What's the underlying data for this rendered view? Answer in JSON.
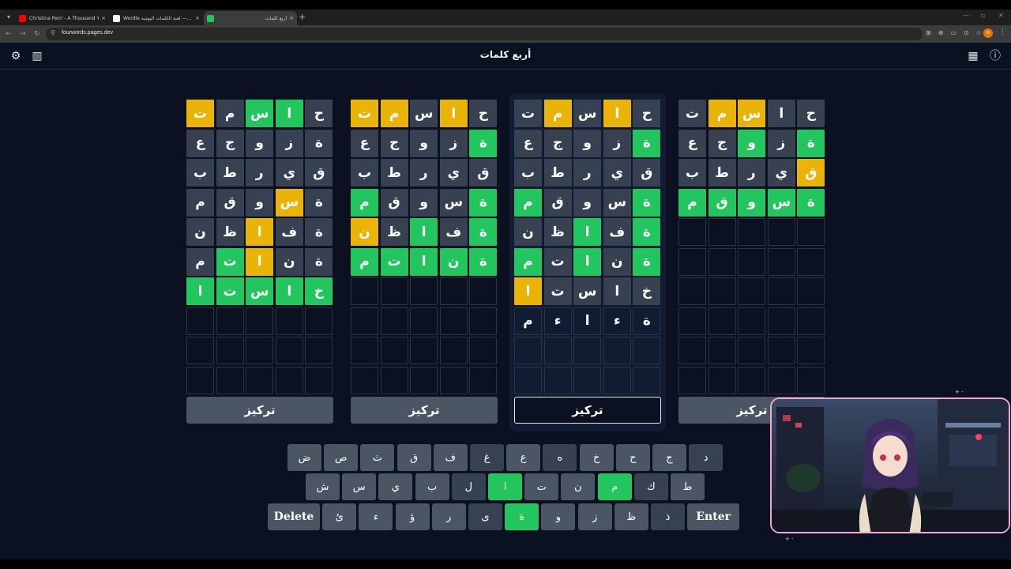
{
  "browser": {
    "tabs": [
      {
        "title": "Christina Perri - A Thousand Ye...",
        "favicon_color": "#ff0000",
        "active": false
      },
      {
        "title": "Wordle لعبة الكلمات اليومية —...",
        "favicon_color": "#ffffff",
        "active": false
      },
      {
        "title": "أربع كلمات",
        "favicon_color": "#22c55e",
        "active": true
      }
    ],
    "new_tab": "+",
    "close": "×",
    "url": "fourwords.pages.dev",
    "profile_initials": "N"
  },
  "app": {
    "title": "أربع كلمات",
    "icons": {
      "settings": "⚙",
      "stats": "▥",
      "calendar": "▦",
      "info": "ⓘ"
    }
  },
  "boards": [
    {
      "rows": [
        [
          [
            "ت",
            "y"
          ],
          [
            "م",
            "n"
          ],
          [
            "س",
            "g"
          ],
          [
            "ا",
            "g"
          ],
          [
            "ح",
            "n"
          ]
        ],
        [
          [
            "ع",
            "n"
          ],
          [
            "ج",
            "n"
          ],
          [
            "و",
            "n"
          ],
          [
            "ز",
            "n"
          ],
          [
            "ة",
            "n"
          ]
        ],
        [
          [
            "ب",
            "n"
          ],
          [
            "ط",
            "n"
          ],
          [
            "ر",
            "n"
          ],
          [
            "ي",
            "n"
          ],
          [
            "ق",
            "n"
          ]
        ],
        [
          [
            "م",
            "n"
          ],
          [
            "ق",
            "n"
          ],
          [
            "و",
            "n"
          ],
          [
            "س",
            "y"
          ],
          [
            "ة",
            "n"
          ]
        ],
        [
          [
            "ن",
            "n"
          ],
          [
            "ظ",
            "n"
          ],
          [
            "ا",
            "y"
          ],
          [
            "ف",
            "n"
          ],
          [
            "ة",
            "n"
          ]
        ],
        [
          [
            "م",
            "n"
          ],
          [
            "ت",
            "g"
          ],
          [
            "ا",
            "y"
          ],
          [
            "ن",
            "n"
          ],
          [
            "ة",
            "n"
          ]
        ],
        [
          [
            "ا",
            "g"
          ],
          [
            "ت",
            "g"
          ],
          [
            "س",
            "g"
          ],
          [
            "ا",
            "g"
          ],
          [
            "خ",
            "g"
          ]
        ],
        [
          [
            "",
            "e"
          ],
          [
            "",
            "e"
          ],
          [
            "",
            "e"
          ],
          [
            "",
            "e"
          ],
          [
            "",
            "e"
          ]
        ],
        [
          [
            "",
            "e"
          ],
          [
            "",
            "e"
          ],
          [
            "",
            "e"
          ],
          [
            "",
            "e"
          ],
          [
            "",
            "e"
          ]
        ],
        [
          [
            "",
            "e"
          ],
          [
            "",
            "e"
          ],
          [
            "",
            "e"
          ],
          [
            "",
            "e"
          ],
          [
            "",
            "e"
          ]
        ]
      ],
      "focus_label": "تركيز",
      "selected": false
    },
    {
      "rows": [
        [
          [
            "ت",
            "y"
          ],
          [
            "م",
            "y"
          ],
          [
            "س",
            "n"
          ],
          [
            "ا",
            "y"
          ],
          [
            "ح",
            "n"
          ]
        ],
        [
          [
            "ع",
            "n"
          ],
          [
            "ج",
            "n"
          ],
          [
            "و",
            "n"
          ],
          [
            "ز",
            "n"
          ],
          [
            "ة",
            "g"
          ]
        ],
        [
          [
            "ب",
            "n"
          ],
          [
            "ط",
            "n"
          ],
          [
            "ر",
            "n"
          ],
          [
            "ي",
            "n"
          ],
          [
            "ق",
            "n"
          ]
        ],
        [
          [
            "م",
            "g"
          ],
          [
            "ق",
            "n"
          ],
          [
            "و",
            "n"
          ],
          [
            "س",
            "n"
          ],
          [
            "ة",
            "g"
          ]
        ],
        [
          [
            "ن",
            "y"
          ],
          [
            "ظ",
            "n"
          ],
          [
            "ا",
            "g"
          ],
          [
            "ف",
            "n"
          ],
          [
            "ة",
            "g"
          ]
        ],
        [
          [
            "م",
            "g"
          ],
          [
            "ت",
            "g"
          ],
          [
            "ا",
            "g"
          ],
          [
            "ن",
            "g"
          ],
          [
            "ة",
            "g"
          ]
        ],
        [
          [
            "",
            "e"
          ],
          [
            "",
            "e"
          ],
          [
            "",
            "e"
          ],
          [
            "",
            "e"
          ],
          [
            "",
            "e"
          ]
        ],
        [
          [
            "",
            "e"
          ],
          [
            "",
            "e"
          ],
          [
            "",
            "e"
          ],
          [
            "",
            "e"
          ],
          [
            "",
            "e"
          ]
        ],
        [
          [
            "",
            "e"
          ],
          [
            "",
            "e"
          ],
          [
            "",
            "e"
          ],
          [
            "",
            "e"
          ],
          [
            "",
            "e"
          ]
        ],
        [
          [
            "",
            "e"
          ],
          [
            "",
            "e"
          ],
          [
            "",
            "e"
          ],
          [
            "",
            "e"
          ],
          [
            "",
            "e"
          ]
        ]
      ],
      "focus_label": "تركيز",
      "selected": false
    },
    {
      "rows": [
        [
          [
            "ت",
            "n"
          ],
          [
            "م",
            "y"
          ],
          [
            "س",
            "n"
          ],
          [
            "ا",
            "y"
          ],
          [
            "ح",
            "n"
          ]
        ],
        [
          [
            "ع",
            "n"
          ],
          [
            "ج",
            "n"
          ],
          [
            "و",
            "n"
          ],
          [
            "ز",
            "n"
          ],
          [
            "ة",
            "g"
          ]
        ],
        [
          [
            "ب",
            "n"
          ],
          [
            "ط",
            "n"
          ],
          [
            "ر",
            "n"
          ],
          [
            "ي",
            "n"
          ],
          [
            "ق",
            "n"
          ]
        ],
        [
          [
            "م",
            "g"
          ],
          [
            "ق",
            "n"
          ],
          [
            "و",
            "n"
          ],
          [
            "س",
            "n"
          ],
          [
            "ة",
            "g"
          ]
        ],
        [
          [
            "ن",
            "n"
          ],
          [
            "ظ",
            "n"
          ],
          [
            "ا",
            "g"
          ],
          [
            "ف",
            "n"
          ],
          [
            "ة",
            "g"
          ]
        ],
        [
          [
            "م",
            "g"
          ],
          [
            "ت",
            "n"
          ],
          [
            "ا",
            "g"
          ],
          [
            "ن",
            "n"
          ],
          [
            "ة",
            "g"
          ]
        ],
        [
          [
            "ا",
            "y"
          ],
          [
            "ت",
            "n"
          ],
          [
            "س",
            "n"
          ],
          [
            "ا",
            "n"
          ],
          [
            "خ",
            "n"
          ]
        ],
        [
          [
            "م",
            "t"
          ],
          [
            "ء",
            "t"
          ],
          [
            "ا",
            "t"
          ],
          [
            "ء",
            "t"
          ],
          [
            "ة",
            "t"
          ]
        ],
        [
          [
            "",
            "e"
          ],
          [
            "",
            "e"
          ],
          [
            "",
            "e"
          ],
          [
            "",
            "e"
          ],
          [
            "",
            "e"
          ]
        ],
        [
          [
            "",
            "e"
          ],
          [
            "",
            "e"
          ],
          [
            "",
            "e"
          ],
          [
            "",
            "e"
          ],
          [
            "",
            "e"
          ]
        ]
      ],
      "focus_label": "تركيز",
      "selected": true
    },
    {
      "rows": [
        [
          [
            "ت",
            "n"
          ],
          [
            "م",
            "y"
          ],
          [
            "س",
            "y"
          ],
          [
            "ا",
            "n"
          ],
          [
            "ح",
            "n"
          ]
        ],
        [
          [
            "ع",
            "n"
          ],
          [
            "ج",
            "n"
          ],
          [
            "و",
            "g"
          ],
          [
            "ز",
            "n"
          ],
          [
            "ة",
            "g"
          ]
        ],
        [
          [
            "ب",
            "n"
          ],
          [
            "ط",
            "n"
          ],
          [
            "ر",
            "n"
          ],
          [
            "ي",
            "n"
          ],
          [
            "ق",
            "y"
          ]
        ],
        [
          [
            "م",
            "g"
          ],
          [
            "ق",
            "g"
          ],
          [
            "و",
            "g"
          ],
          [
            "س",
            "g"
          ],
          [
            "ة",
            "g"
          ]
        ],
        [
          [
            "",
            "e"
          ],
          [
            "",
            "e"
          ],
          [
            "",
            "e"
          ],
          [
            "",
            "e"
          ],
          [
            "",
            "e"
          ]
        ],
        [
          [
            "",
            "e"
          ],
          [
            "",
            "e"
          ],
          [
            "",
            "e"
          ],
          [
            "",
            "e"
          ],
          [
            "",
            "e"
          ]
        ],
        [
          [
            "",
            "e"
          ],
          [
            "",
            "e"
          ],
          [
            "",
            "e"
          ],
          [
            "",
            "e"
          ],
          [
            "",
            "e"
          ]
        ],
        [
          [
            "",
            "e"
          ],
          [
            "",
            "e"
          ],
          [
            "",
            "e"
          ],
          [
            "",
            "e"
          ],
          [
            "",
            "e"
          ]
        ],
        [
          [
            "",
            "e"
          ],
          [
            "",
            "e"
          ],
          [
            "",
            "e"
          ],
          [
            "",
            "e"
          ],
          [
            "",
            "e"
          ]
        ],
        [
          [
            "",
            "e"
          ],
          [
            "",
            "e"
          ],
          [
            "",
            "e"
          ],
          [
            "",
            "e"
          ],
          [
            "",
            "e"
          ]
        ]
      ],
      "focus_label": "تركيز",
      "selected": false
    }
  ],
  "keyboard": {
    "rows": [
      [
        [
          "ض",
          "k"
        ],
        [
          "ص",
          "k"
        ],
        [
          "ث",
          "k"
        ],
        [
          "ق",
          "k"
        ],
        [
          "ف",
          "k"
        ],
        [
          "غ",
          "d"
        ],
        [
          "ع",
          "k"
        ],
        [
          "ه",
          "d"
        ],
        [
          "خ",
          "k"
        ],
        [
          "ح",
          "k"
        ],
        [
          "ج",
          "k"
        ],
        [
          "د",
          "d"
        ]
      ],
      [
        [
          "ش",
          "k"
        ],
        [
          "س",
          "k"
        ],
        [
          "ي",
          "k"
        ],
        [
          "ب",
          "k"
        ],
        [
          "ل",
          "d"
        ],
        [
          "ا",
          "g"
        ],
        [
          "ت",
          "k"
        ],
        [
          "ن",
          "k"
        ],
        [
          "م",
          "g"
        ],
        [
          "ك",
          "d"
        ],
        [
          "ط",
          "k"
        ]
      ],
      [
        [
          "Delete",
          "w"
        ],
        [
          "ئ",
          "k"
        ],
        [
          "ء",
          "k"
        ],
        [
          "ؤ",
          "k"
        ],
        [
          "ر",
          "k"
        ],
        [
          "ى",
          "d"
        ],
        [
          "ة",
          "g"
        ],
        [
          "و",
          "k"
        ],
        [
          "ز",
          "k"
        ],
        [
          "ظ",
          "k"
        ],
        [
          "ذ",
          "d"
        ],
        [
          "Enter",
          "w"
        ]
      ]
    ]
  },
  "colors": {
    "green": "#22c55e",
    "yellow": "#eab308",
    "tile_dark": "#374151",
    "background": "#0b1120",
    "cam_border": "#f4a6d7"
  }
}
